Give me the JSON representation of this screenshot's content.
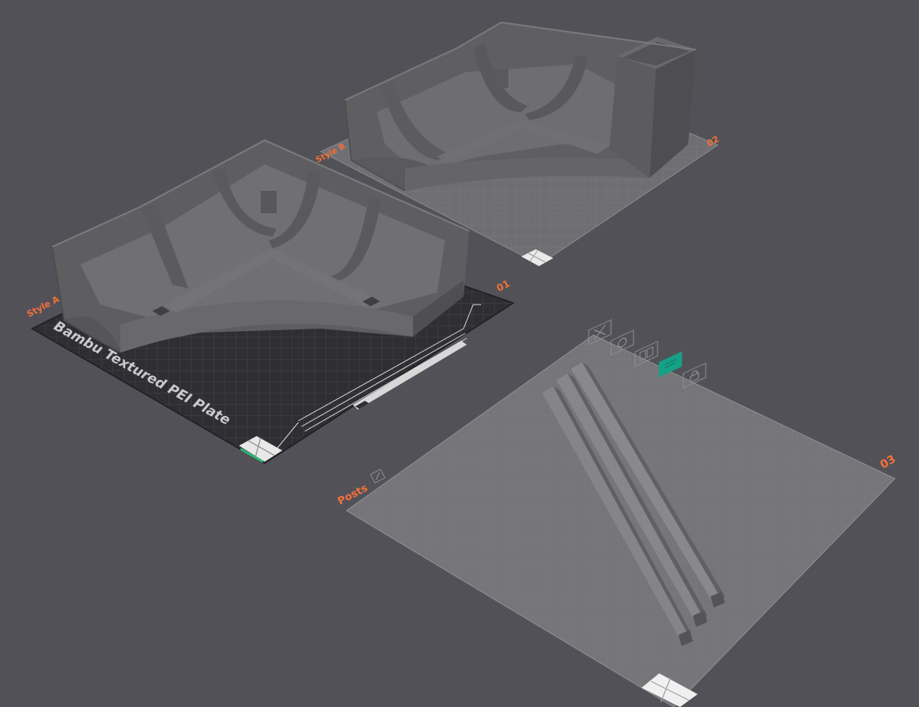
{
  "scene": {
    "background_color": "#525158",
    "accent_color": "#f2703a",
    "selected_plate_color": "#16a085"
  },
  "plates": [
    {
      "number": "01",
      "name": "Style A",
      "bed_label": "Bambu Textured PEI Plate",
      "bed_type": "textured-pei"
    },
    {
      "number": "02",
      "name": "Style B",
      "bed_type": "default"
    },
    {
      "number": "03",
      "name": "Posts",
      "bed_type": "default",
      "toolbar_icons": [
        "close-icon",
        "orient-icon",
        "arrange-icon",
        "plate-settings-icon",
        "lock-icon"
      ]
    }
  ],
  "objects": [
    {
      "name": "tray-style-a",
      "plate": "01"
    },
    {
      "name": "tray-style-b",
      "plate": "02"
    },
    {
      "name": "post-1",
      "plate": "03"
    },
    {
      "name": "post-2",
      "plate": "03"
    },
    {
      "name": "post-3",
      "plate": "03"
    }
  ]
}
